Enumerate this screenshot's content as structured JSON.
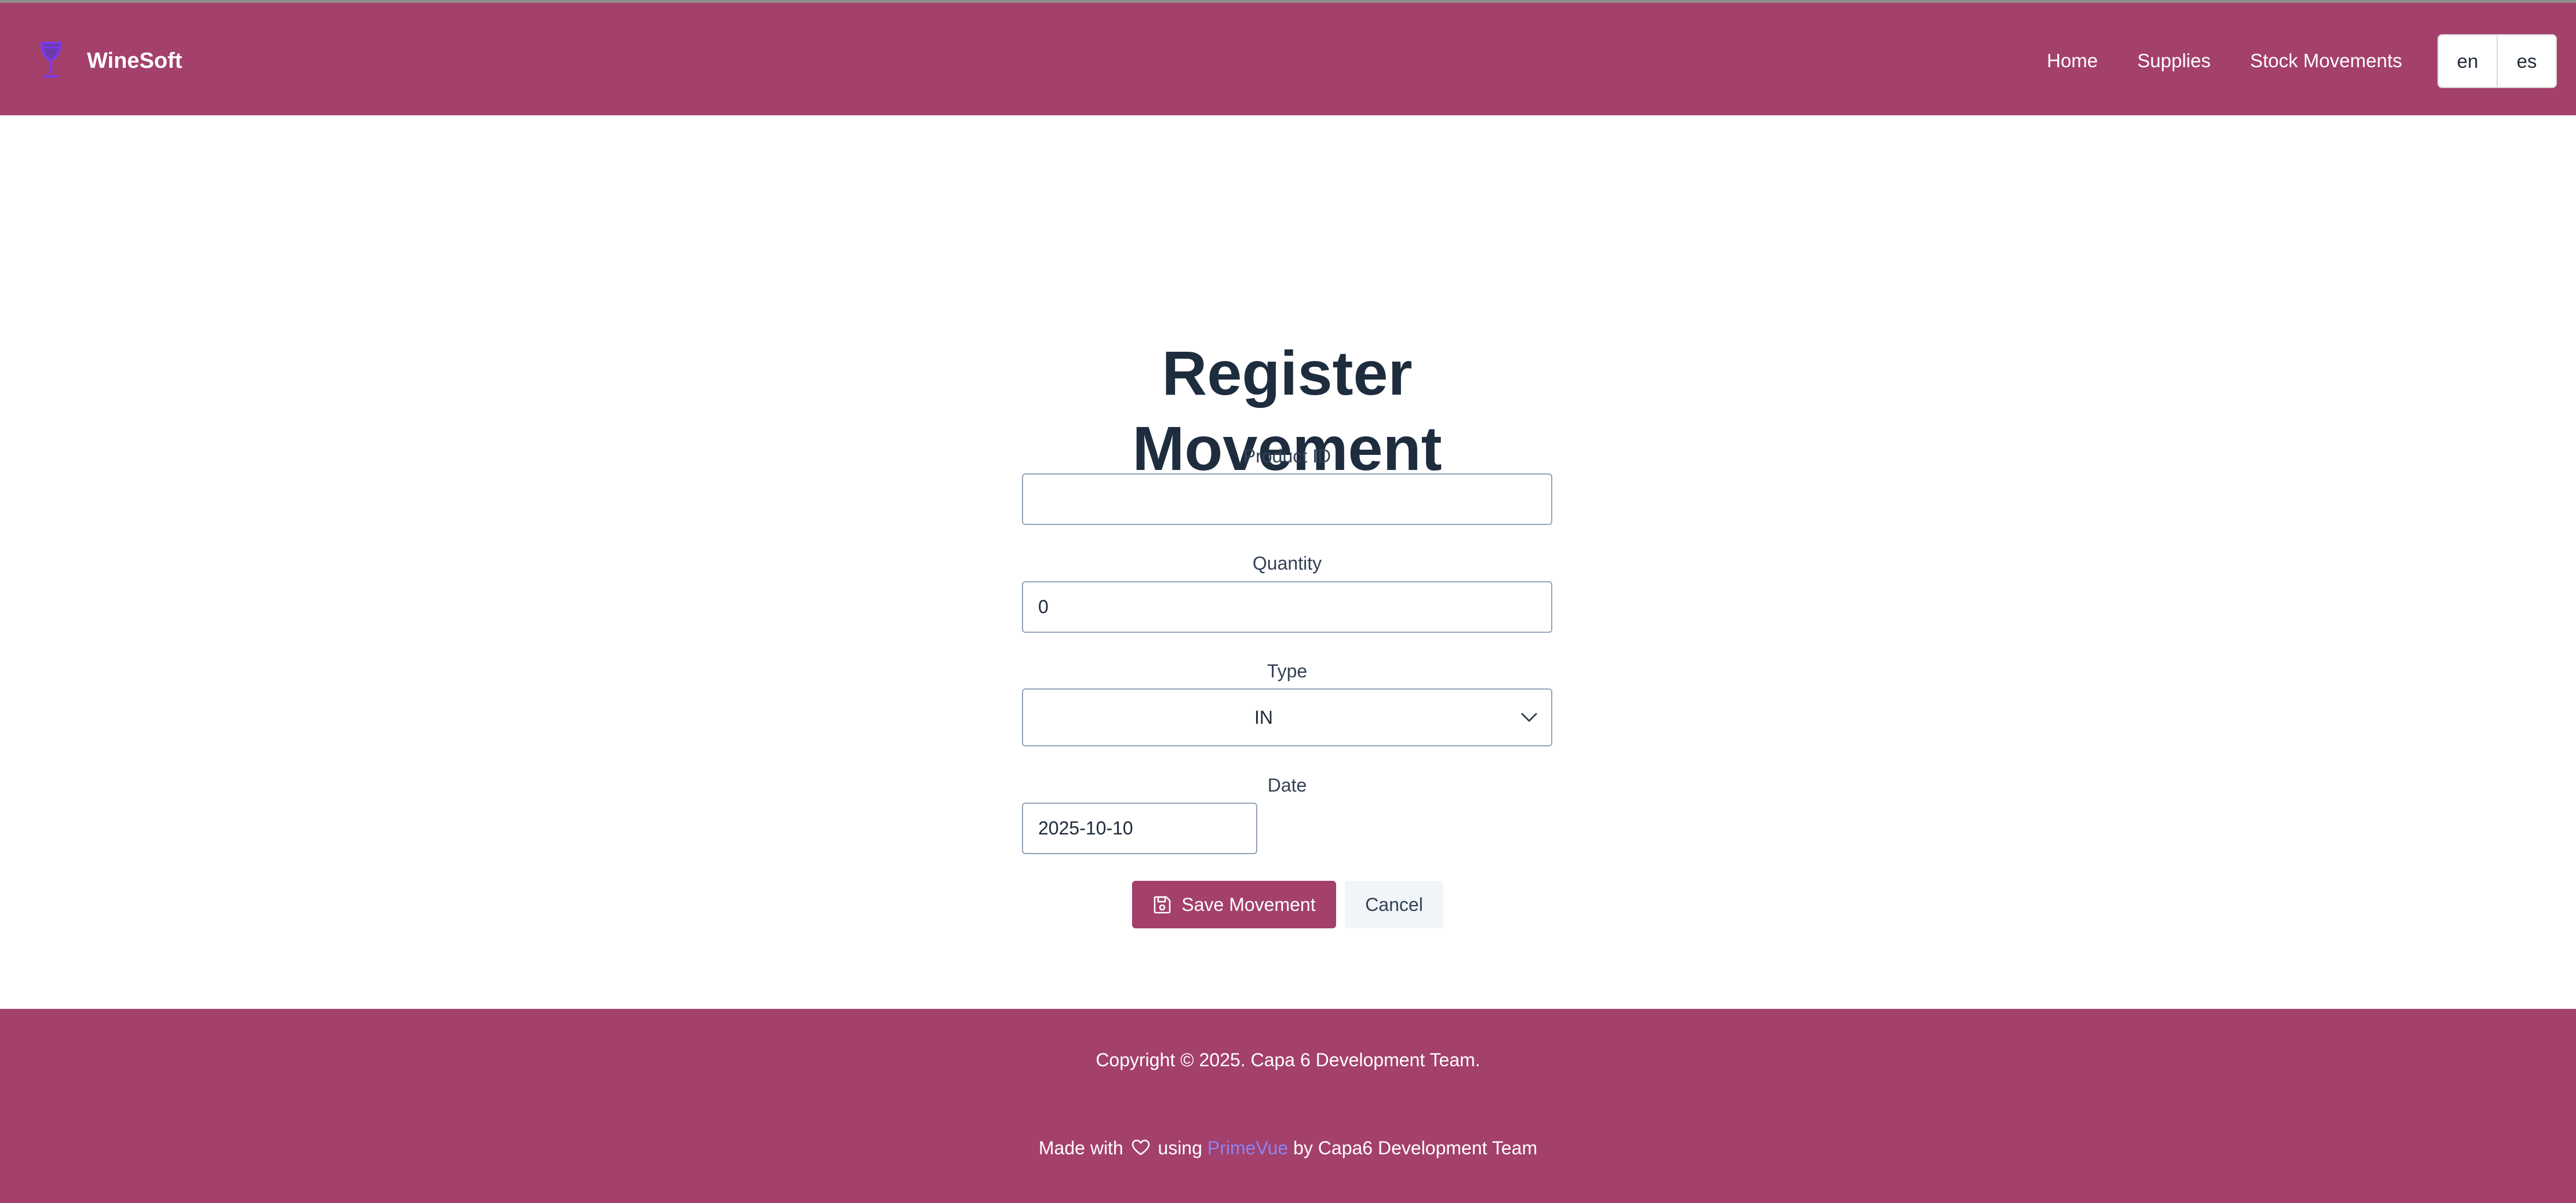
{
  "header": {
    "brand_name": "WineSoft",
    "brand_icon": "wine-glass-icon",
    "nav": {
      "home": "Home",
      "supplies": "Supplies",
      "stock_movements": "Stock Movements"
    },
    "languages": {
      "en": "en",
      "es": "es"
    }
  },
  "form": {
    "title": "Register Movement",
    "product_id": {
      "label": "Product ID",
      "value": ""
    },
    "quantity": {
      "label": "Quantity",
      "value": "0"
    },
    "type": {
      "label": "Type",
      "selected": "IN"
    },
    "date": {
      "label": "Date",
      "value": "2025-10-10"
    },
    "save_label": "Save Movement",
    "cancel_label": "Cancel"
  },
  "footer": {
    "copyright": "Copyright © 2025. Capa 6 Development Team.",
    "made_with_prefix": "Made with",
    "made_with_using": "using",
    "primevue": "PrimeVue",
    "made_with_suffix": "by Capa6 Development Team"
  },
  "colors": {
    "brand": "#a3406b",
    "title": "#1e2d3e",
    "link": "#8b83f5",
    "icon_purple": "#7c3aed"
  }
}
